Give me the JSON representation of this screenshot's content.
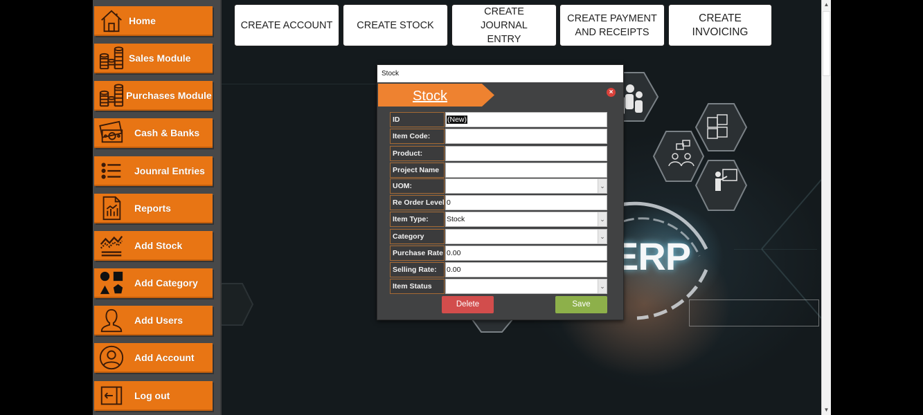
{
  "sidebar": {
    "items": [
      {
        "label": "Home",
        "icon": "home-icon"
      },
      {
        "label": "Sales Module",
        "icon": "coins-stack-icon"
      },
      {
        "label": "Purchases Module",
        "icon": "coins-stack-icon"
      },
      {
        "label": "Cash & Banks",
        "icon": "cash-icon"
      },
      {
        "label": "Jounral Entries",
        "icon": "list-icon"
      },
      {
        "label": "Reports",
        "icon": "report-icon"
      },
      {
        "label": "Add Stock",
        "icon": "stock-chart-icon"
      },
      {
        "label": "Add Category",
        "icon": "shapes-icon"
      },
      {
        "label": "Add Users",
        "icon": "user-icon"
      },
      {
        "label": "Add Account",
        "icon": "account-circle-icon"
      },
      {
        "label": "Log out",
        "icon": "logout-icon"
      }
    ]
  },
  "toolbar": {
    "buttons": [
      {
        "label": "CREATE ACCOUNT"
      },
      {
        "label": "CREATE STOCK"
      },
      {
        "label": "CREATE JOURNAL ENTRY"
      },
      {
        "label": "CREATE PAYMENT AND RECEIPTS"
      },
      {
        "label": "CREATE INVOICING"
      }
    ]
  },
  "background": {
    "erp_text": "ERP"
  },
  "dialog": {
    "window_title": "Stock",
    "header_title": "Stock",
    "close_symbol": "×",
    "fields": [
      {
        "label": "ID",
        "value": "(New)",
        "type": "text"
      },
      {
        "label": "Item Code:",
        "value": "",
        "type": "text"
      },
      {
        "label": "Product:",
        "value": "",
        "type": "text"
      },
      {
        "label": "Project Name",
        "value": "",
        "type": "text"
      },
      {
        "label": "UOM:",
        "value": "",
        "type": "select"
      },
      {
        "label": "Re Order Level",
        "value": "0",
        "type": "text"
      },
      {
        "label": "Item Type:",
        "value": "Stock",
        "type": "select"
      },
      {
        "label": "Category",
        "value": "",
        "type": "select"
      },
      {
        "label": "Purchase Rate:",
        "value": "0.00",
        "type": "text"
      },
      {
        "label": "Selling Rate:",
        "value": "0.00",
        "type": "text"
      },
      {
        "label": "Item Status",
        "value": "",
        "type": "select"
      }
    ],
    "delete_label": "Delete",
    "save_label": "Save"
  },
  "colors": {
    "sidebar_item": "#e87514",
    "sidebar_bg": "#474849",
    "dialog_bg": "#414243",
    "header_orange": "#ee8230",
    "delete_red": "#d24d4c",
    "save_green": "#8db04a",
    "close_red": "#d9413a"
  },
  "scrollbar": {
    "up_symbol": "▲",
    "down_symbol": "▼"
  }
}
